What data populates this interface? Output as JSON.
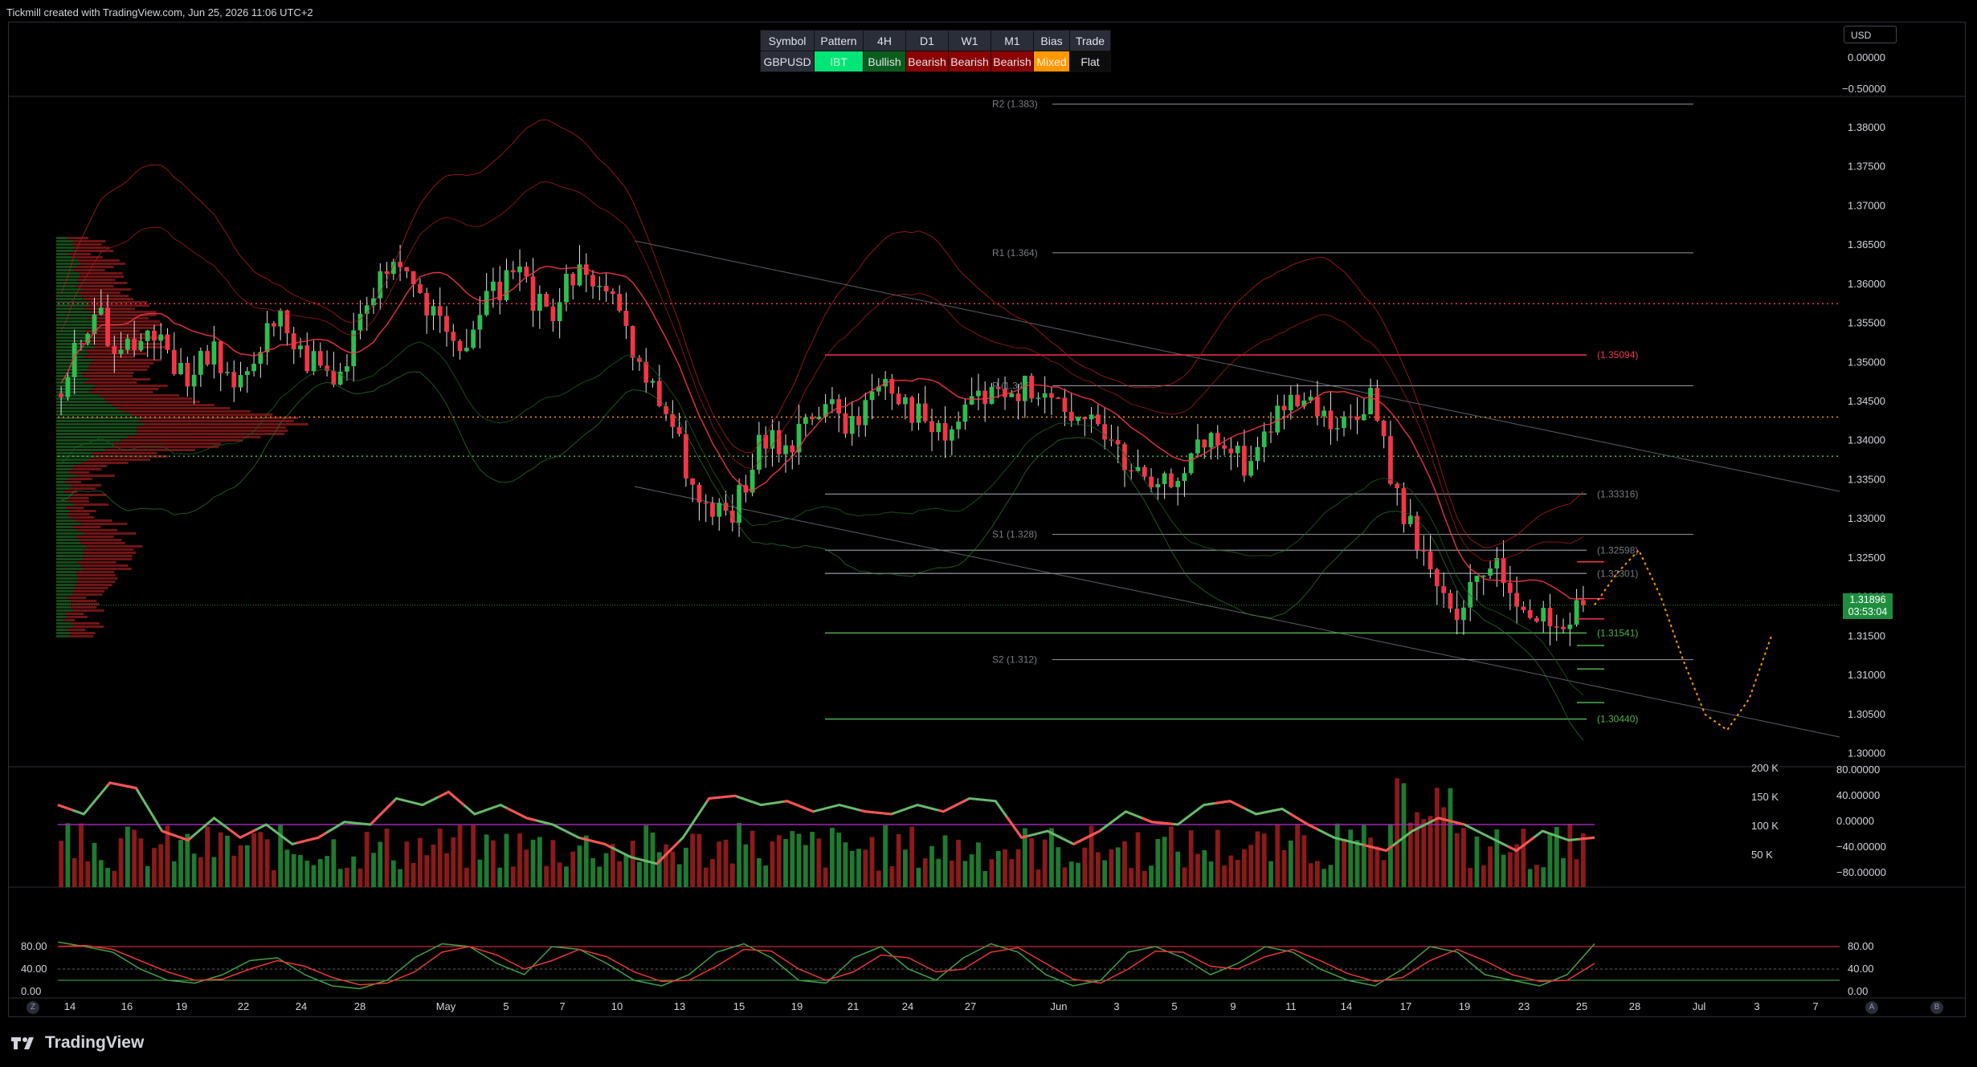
{
  "header": {
    "credit": "Tickmill created with TradingView.com, Jun 25, 2026 11:06 UTC+2"
  },
  "branding": {
    "logo_text": "TradingView"
  },
  "currency_selector": {
    "label": "USD"
  },
  "bias_table": {
    "headers": [
      "Symbol",
      "Pattern",
      "4H",
      "D1",
      "W1",
      "M1",
      "Bias",
      "Trade"
    ],
    "values": [
      "GBPUSD",
      "IBT",
      "Bullish",
      "Bearish",
      "Bearish",
      "Bearish",
      "Mixed",
      "Flat"
    ],
    "value_colors": [
      "#2a2e39",
      "#00e676",
      "#0b5d1e",
      "#8b0000",
      "#8b0000",
      "#8b0000",
      "#ff9800",
      "#0d0d0d"
    ],
    "value_text_colors": [
      "#e0e3eb",
      "#c8ffd8",
      "#e0e3eb",
      "#e0e3eb",
      "#e0e3eb",
      "#e0e3eb",
      "#fff3e0",
      "#e0e3eb"
    ]
  },
  "current_price": {
    "price": "1.31896",
    "countdown": "03:53:04"
  },
  "bottom_buttons": {
    "left": "Z",
    "mid_a": "A",
    "mid_b": "B"
  },
  "colors": {
    "bull": "#26a69a",
    "bull_candle": "#2ebd4f",
    "bear": "#f23645",
    "bg": "#000000",
    "projection": "#ff9800"
  },
  "chart_data": [
    {
      "type": "candlestick",
      "symbol": "GBPUSD",
      "y_axis": {
        "ticks": [
          "1.38000",
          "1.37500",
          "1.37000",
          "1.36500",
          "1.36000",
          "1.35500",
          "1.35000",
          "1.34500",
          "1.34000",
          "1.33500",
          "1.33000",
          "1.32500",
          "1.32000",
          "1.31500",
          "1.31000",
          "1.30500",
          "1.30000"
        ],
        "range": [
          1.298,
          1.384
        ]
      },
      "x_axis": {
        "ticks": [
          "14",
          "16",
          "19",
          "22",
          "24",
          "28",
          "May",
          "5",
          "7",
          "10",
          "13",
          "15",
          "19",
          "21",
          "24",
          "27",
          "Jun",
          "3",
          "5",
          "9",
          "11",
          "14",
          "17",
          "19",
          "23",
          "25",
          "28",
          "Jul",
          "3",
          "7"
        ]
      },
      "pivot_levels": [
        {
          "label": "R2 (1.383)",
          "value": 1.383
        },
        {
          "label": "R1 (1.364)",
          "value": 1.364
        },
        {
          "label": "P (1.347)",
          "value": 1.347
        },
        {
          "label": "S1 (1.328)",
          "value": 1.328
        },
        {
          "label": "S2 (1.312)",
          "value": 1.312
        }
      ],
      "key_levels": [
        {
          "label": "(1.35094)",
          "value": 1.35094,
          "color": "#f23645"
        },
        {
          "label": "(1.33316)",
          "value": 1.33316,
          "color": "#787b86"
        },
        {
          "label": "(1.32598)",
          "value": 1.32598,
          "color": "#787b86"
        },
        {
          "label": "(1.32301)",
          "value": 1.32301,
          "color": "#787b86"
        },
        {
          "label": "(1.31541)",
          "value": 1.31541,
          "color": "#4caf50"
        },
        {
          "label": "(1.30440)",
          "value": 1.3044,
          "color": "#4caf50"
        }
      ],
      "dotted_levels": [
        1.3575,
        1.343,
        1.338
      ],
      "close_path": [
        1.346,
        1.357,
        1.351,
        1.354,
        1.348,
        1.351,
        1.346,
        1.356,
        1.351,
        1.346,
        1.358,
        1.364,
        1.357,
        1.351,
        1.358,
        1.361,
        1.356,
        1.363,
        1.358,
        1.349,
        1.343,
        1.331,
        1.33,
        1.34,
        1.34,
        1.345,
        1.342,
        1.349,
        1.344,
        1.34,
        1.346,
        1.345,
        1.347,
        1.343,
        1.343,
        1.337,
        1.333,
        1.338,
        1.34,
        1.337,
        1.344,
        1.344,
        1.341,
        1.346,
        1.331,
        1.323,
        1.318,
        1.325,
        1.319,
        1.316,
        1.319
      ],
      "projection_path": [
        1.319,
        1.323,
        1.326,
        1.32,
        1.312,
        1.305,
        1.303,
        1.307,
        1.315
      ],
      "last_price": 1.31896
    },
    {
      "type": "line+bar",
      "name": "volume oscillator",
      "right_ticks": [
        "80.00000",
        "40.00000",
        "0.00000",
        "−40.00000",
        "−80.00000"
      ],
      "volume_ticks": [
        "200 K",
        "150 K",
        "100 K",
        "50 K"
      ],
      "top_ticks": [
        "0.00000",
        "−0.50000"
      ],
      "level_line": 100,
      "oscillator_path": [
        55,
        48,
        72,
        68,
        35,
        28,
        45,
        30,
        40,
        25,
        30,
        42,
        40,
        60,
        55,
        65,
        48,
        55,
        45,
        40,
        30,
        25,
        15,
        10,
        30,
        60,
        62,
        55,
        58,
        50,
        55,
        50,
        48,
        55,
        50,
        60,
        58,
        30,
        35,
        25,
        35,
        50,
        42,
        40,
        55,
        58,
        48,
        52,
        40,
        30,
        25,
        20,
        35,
        45,
        40,
        30,
        20,
        35,
        28,
        30
      ]
    },
    {
      "type": "line",
      "name": "stochastic",
      "ticks": [
        "80.00",
        "40.00",
        "0.00"
      ],
      "levels": [
        80,
        20
      ],
      "k_path": [
        88,
        80,
        70,
        40,
        20,
        15,
        30,
        55,
        60,
        30,
        10,
        5,
        20,
        60,
        85,
        80,
        50,
        30,
        80,
        75,
        50,
        20,
        10,
        30,
        70,
        85,
        60,
        20,
        15,
        60,
        80,
        40,
        20,
        60,
        85,
        70,
        30,
        10,
        20,
        70,
        80,
        60,
        30,
        50,
        80,
        70,
        40,
        20,
        10,
        40,
        80,
        70,
        30,
        20,
        10,
        30,
        85
      ],
      "d_path": [
        80,
        82,
        75,
        55,
        35,
        20,
        22,
        40,
        55,
        45,
        25,
        12,
        15,
        35,
        70,
        80,
        65,
        40,
        55,
        75,
        62,
        35,
        18,
        20,
        45,
        75,
        72,
        40,
        20,
        35,
        65,
        60,
        35,
        40,
        70,
        78,
        50,
        22,
        15,
        40,
        72,
        70,
        45,
        40,
        62,
        75,
        55,
        32,
        18,
        25,
        55,
        75,
        55,
        30,
        18,
        20,
        50
      ]
    }
  ]
}
